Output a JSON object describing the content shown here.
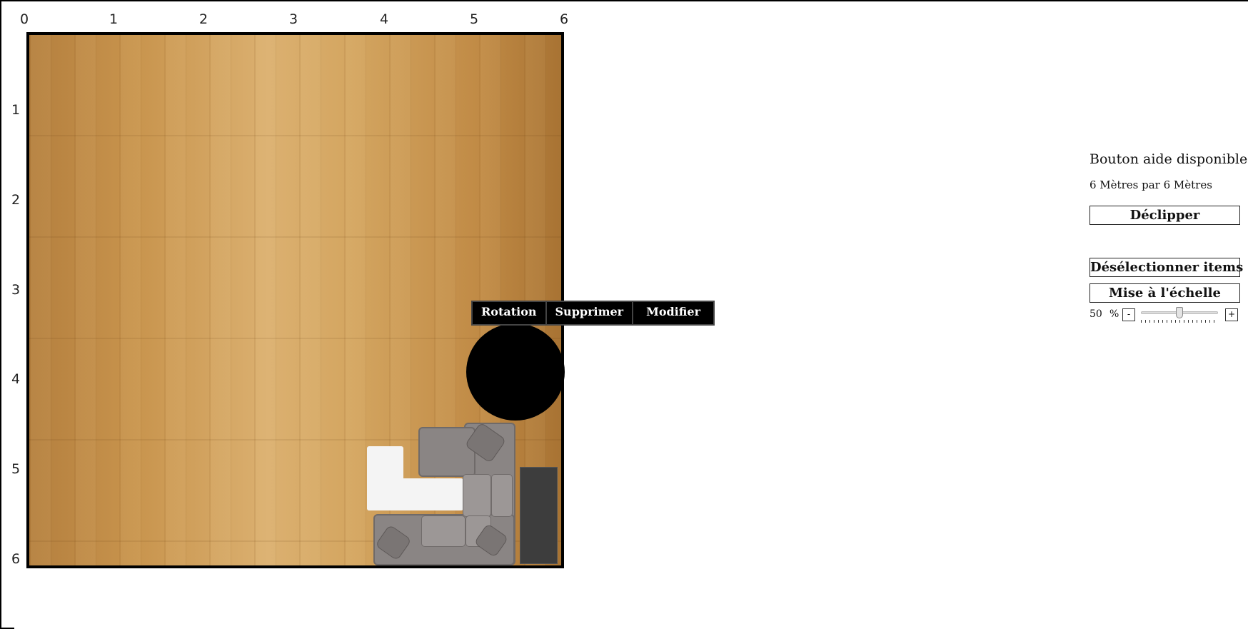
{
  "ruler": {
    "x_labels": [
      "0",
      "1",
      "2",
      "3",
      "4",
      "5",
      "6"
    ],
    "y_labels": [
      "1",
      "2",
      "3",
      "4",
      "5",
      "6"
    ]
  },
  "context_menu": {
    "rotate_label": "Rotation",
    "delete_label": "Supprimer",
    "edit_label": "Modifier"
  },
  "panel": {
    "help_text": "Bouton aide disponible!",
    "dimensions_text": "6 Mètres par 6 Mètres",
    "unclip_label": "Déclipper",
    "deselect_label": "Désélectionner items",
    "scale_label": "Mise à l'échelle",
    "scale_value": "50",
    "scale_unit": "%",
    "decrement_label": "-",
    "increment_label": "+",
    "scale_fraction": 0.5
  },
  "colors": {
    "floor": "#d4a661",
    "room_border": "#000000",
    "selected_item": "#000000",
    "cabinet": "#3d3d3d",
    "sofa": "#8a8584",
    "desk": "#f4f4f4"
  },
  "icons": [
    "floor-plan",
    "sofa",
    "desk",
    "round-table",
    "cabinet"
  ]
}
